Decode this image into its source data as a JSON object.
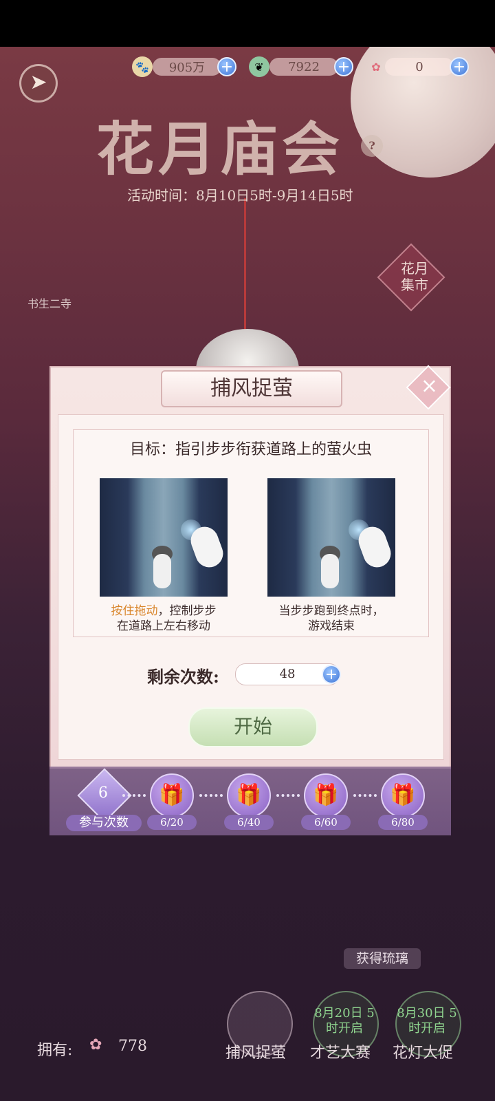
{
  "currencies": [
    {
      "icon": "paw-coin-icon",
      "value": "905万"
    },
    {
      "icon": "jade-icon",
      "value": "7922"
    },
    {
      "icon": "glass-flower-icon",
      "value": "0"
    }
  ],
  "event": {
    "title": "花月庙会",
    "time": "活动时间：8月10日5时-9月14日5时",
    "market_label": "花月集市",
    "side_label": "书生二寺"
  },
  "dialog": {
    "title": "捕风捉萤",
    "goal": "目标：指引步步衔获道路上的萤火虫",
    "caption_left_highlight": "按住拖动",
    "caption_left_rest": "，控制步步",
    "caption_left_line2": "在道路上左右移动",
    "caption_right_line1": "当步步跑到终点时，",
    "caption_right_line2": "游戏结束",
    "remaining_label": "剩余次数:",
    "remaining_value": "48",
    "start_label": "开始"
  },
  "progress": {
    "count": "6",
    "count_label": "参与次数",
    "milestones": [
      "6/20",
      "6/40",
      "6/60",
      "6/80"
    ]
  },
  "bottom": {
    "owned_label": "拥有:",
    "owned_value": "778",
    "obtain_label": "获得琉璃",
    "games": [
      {
        "label": "捕风捉萤",
        "status": ""
      },
      {
        "label": "才艺大赛",
        "status": "8月20日 5时开启"
      },
      {
        "label": "花灯大促",
        "status": "8月30日 5时开启"
      }
    ]
  },
  "colors": {
    "accent": "#8a6bb5",
    "start": "#c5dfb3",
    "highlight": "#d9862c"
  }
}
